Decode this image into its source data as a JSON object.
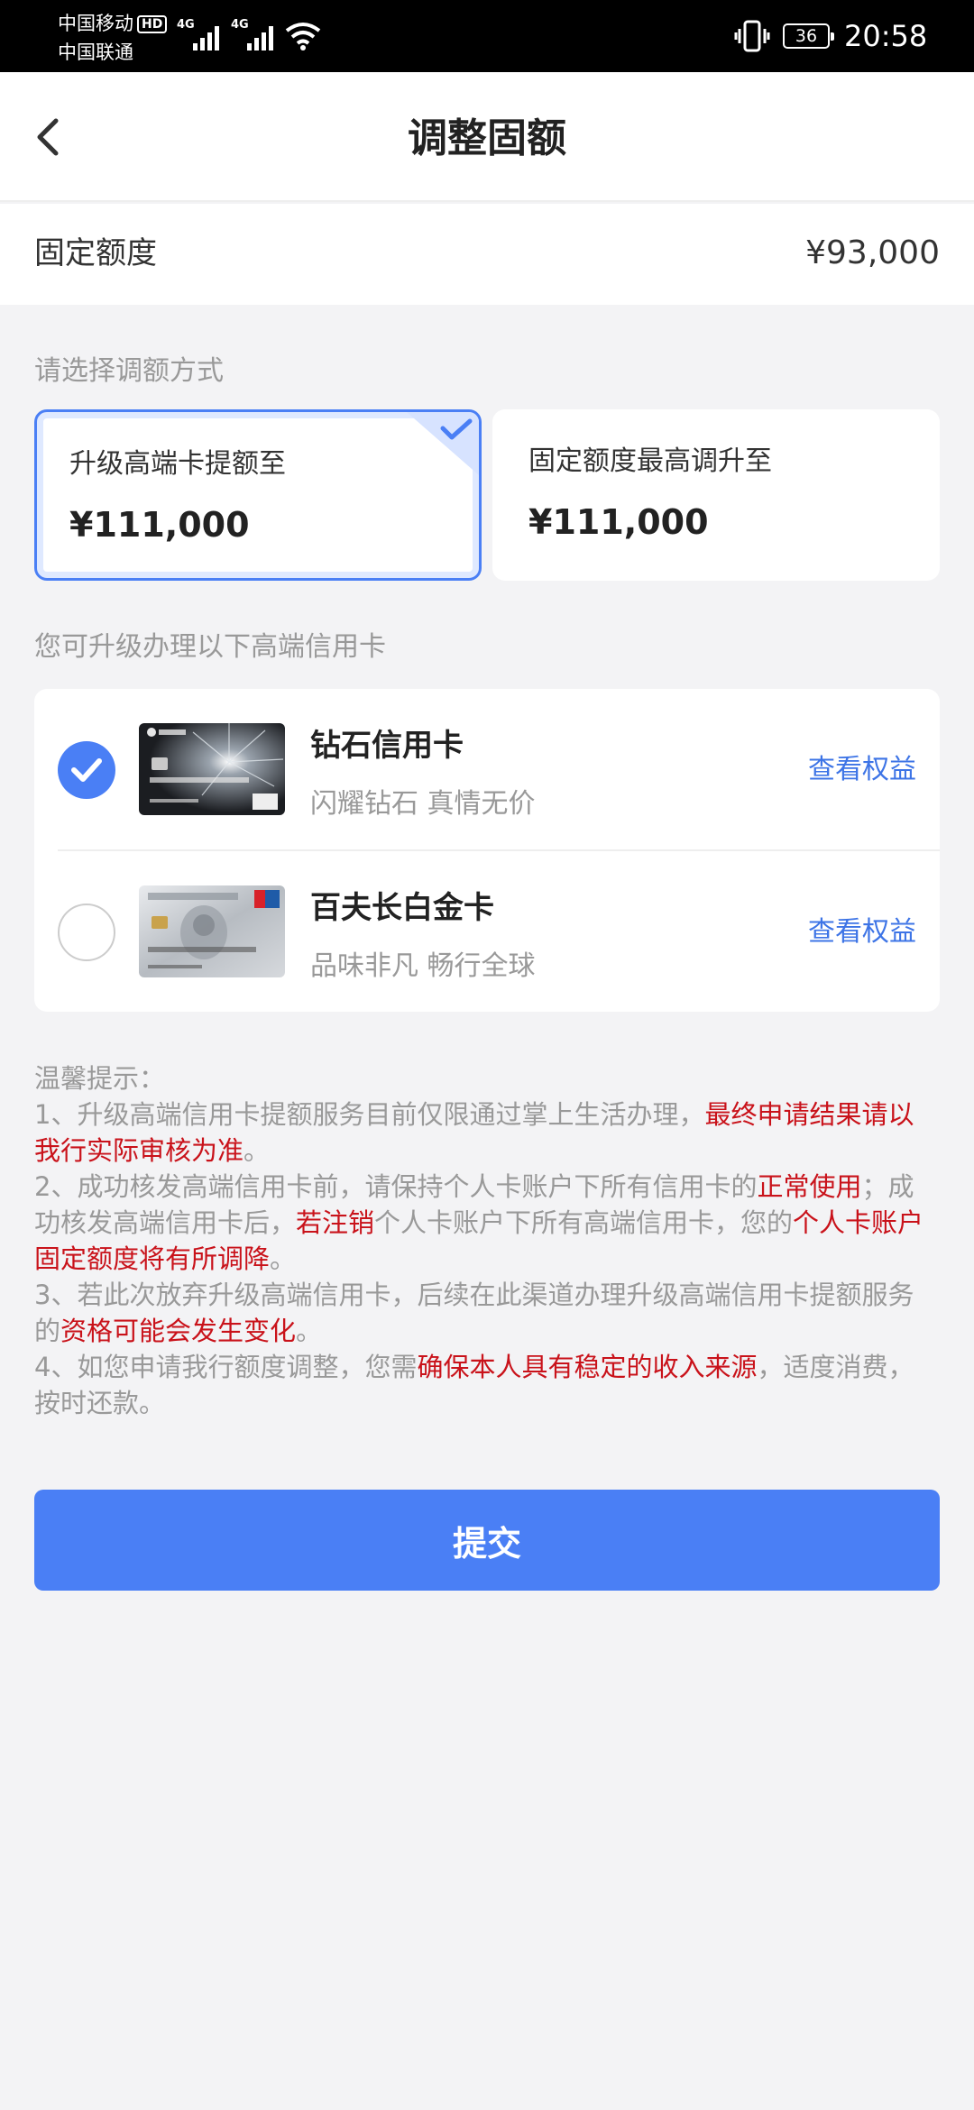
{
  "status_bar": {
    "carrier1": "中国移动",
    "carrier1_badge": "HD",
    "carrier2": "中国联通",
    "network1": "4G",
    "network2": "4G",
    "battery": "36",
    "time": "20:58"
  },
  "header": {
    "title": "调整固额"
  },
  "fixed_quota": {
    "label": "固定额度",
    "value": "¥93,000"
  },
  "adjust_section": {
    "title": "请选择调额方式",
    "options": [
      {
        "label": "升级高端卡提额至",
        "amount": "¥111,000",
        "selected": true
      },
      {
        "label": "固定额度最高调升至",
        "amount": "¥111,000",
        "selected": false
      }
    ]
  },
  "cards_section": {
    "title": "您可升级办理以下高端信用卡",
    "cards": [
      {
        "name": "钻石信用卡",
        "desc": "闪耀钻石 真情无价",
        "link": "查看权益",
        "selected": true
      },
      {
        "name": "百夫长白金卡",
        "desc": "品味非凡 畅行全球",
        "link": "查看权益",
        "selected": false
      }
    ]
  },
  "notice": {
    "title": "温馨提示：",
    "item1_a": "1、升级高端信用卡提额服务目前仅限通过掌上生活办理，",
    "item1_b": "最终申请结果请以我行实际审核为准",
    "item1_c": "。",
    "item2_a": "2、成功核发高端信用卡前，请保持个人卡账户下所有信用卡的",
    "item2_b": "正常使用",
    "item2_c": "；成功核发高端信用卡后，",
    "item2_d": "若注销",
    "item2_e": "个人卡账户下所有高端信用卡，您的",
    "item2_f": "个人卡账户固定额度将有所调降",
    "item2_g": "。",
    "item3_a": "3、若此次放弃升级高端信用卡，后续在此渠道办理升级高端信用卡提额服务的",
    "item3_b": "资格可能会发生变化",
    "item3_c": "。",
    "item4_a": "4、如您申请我行额度调整，您需",
    "item4_b": "确保本人具有稳定的收入来源",
    "item4_c": "，适度消费，按时还款。"
  },
  "submit_label": "提交",
  "colors": {
    "accent": "#4a7ff5",
    "link": "#3d74e6",
    "warning": "#c9121a",
    "background": "#f3f3f5"
  },
  "icons": [
    "back-arrow-icon",
    "check-icon",
    "wifi-icon",
    "vibrate-icon",
    "signal-icon",
    "battery-icon"
  ]
}
